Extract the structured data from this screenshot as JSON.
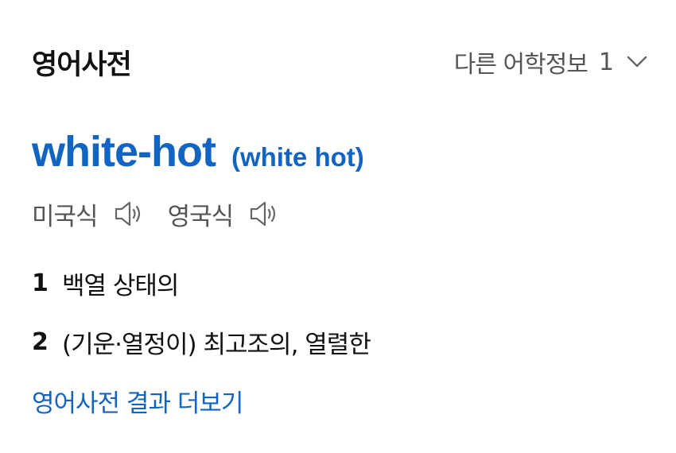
{
  "header": {
    "title": "영어사전",
    "more_languages_label": "다른 어학정보",
    "more_languages_count": "1",
    "chevron_icon": "chevron-down-icon"
  },
  "entry": {
    "headword": "white-hot",
    "variant": "(white hot)",
    "pronunciations": [
      {
        "label": "미국식",
        "icon": "speaker-icon"
      },
      {
        "label": "영국식",
        "icon": "speaker-icon"
      }
    ],
    "meanings": [
      {
        "num": "1",
        "text": "백열 상태의"
      },
      {
        "num": "2",
        "text": "(기운·열정이) 최고조의, 열렬한"
      }
    ]
  },
  "footer": {
    "more_results_label": "영어사전 결과 더보기"
  },
  "colors": {
    "accent_blue": "#1164c2",
    "muted_gray": "#555555",
    "text_dark": "#111111"
  }
}
